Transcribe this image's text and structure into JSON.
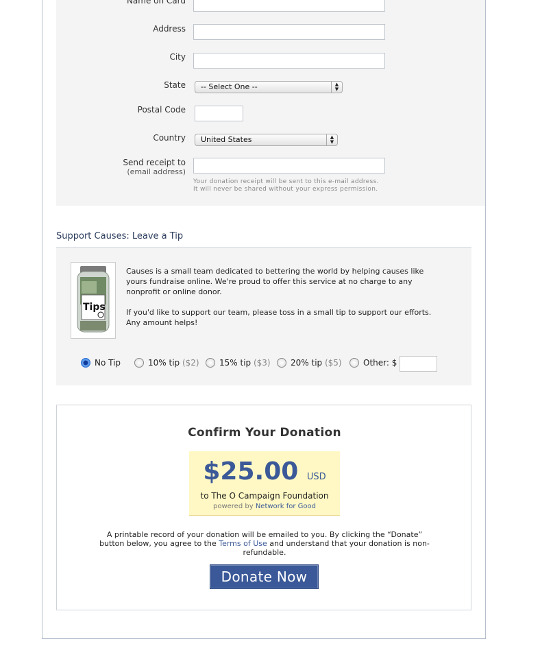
{
  "form": {
    "name_on_card_label": "Name on Card",
    "address_label": "Address",
    "city_label": "City",
    "state_label": "State",
    "state_value": "-- Select One --",
    "postal_code_label": "Postal Code",
    "country_label": "Country",
    "country_value": "United States",
    "receipt_label": "Send receipt to",
    "receipt_sublabel": "(email address)",
    "receipt_hint": "Your donation receipt will be sent to this e-mail address. It will never be shared without your express permission."
  },
  "tip": {
    "section_title": "Support Causes: Leave a Tip",
    "jar_label": "Tips",
    "paragraph1": "Causes is a small team dedicated to bettering the world by helping causes like yours fundraise online. We're proud to offer this service at no charge to any nonprofit or online donor.",
    "paragraph2": "If you'd like to support our team, please toss in a small tip to support our efforts. Any amount helps!",
    "options": [
      {
        "label": "No Tip",
        "amount": "",
        "selected": true
      },
      {
        "label": "10% tip",
        "amount": "($2)",
        "selected": false
      },
      {
        "label": "15% tip",
        "amount": "($3)",
        "selected": false
      },
      {
        "label": "20% tip",
        "amount": "($5)",
        "selected": false
      },
      {
        "label": "Other: $",
        "amount": "",
        "selected": false
      }
    ]
  },
  "confirm": {
    "title": "Confirm Your Donation",
    "amount": "$25.00",
    "currency": "USD",
    "to_line": "to The O Campaign Foundation",
    "powered_by": "powered by",
    "powered_link": "Network for Good",
    "terms_before": "A printable record of your donation will be emailed to you. By clicking the “Donate” button below, you agree to the",
    "terms_link": "Terms of Use",
    "terms_after": "and understand that your donation is non-refundable.",
    "donate_button": "Donate Now"
  },
  "colors": {
    "accent": "#3b5998",
    "panel": "#f4f4f4",
    "amount_bg": "#fff8c4"
  }
}
